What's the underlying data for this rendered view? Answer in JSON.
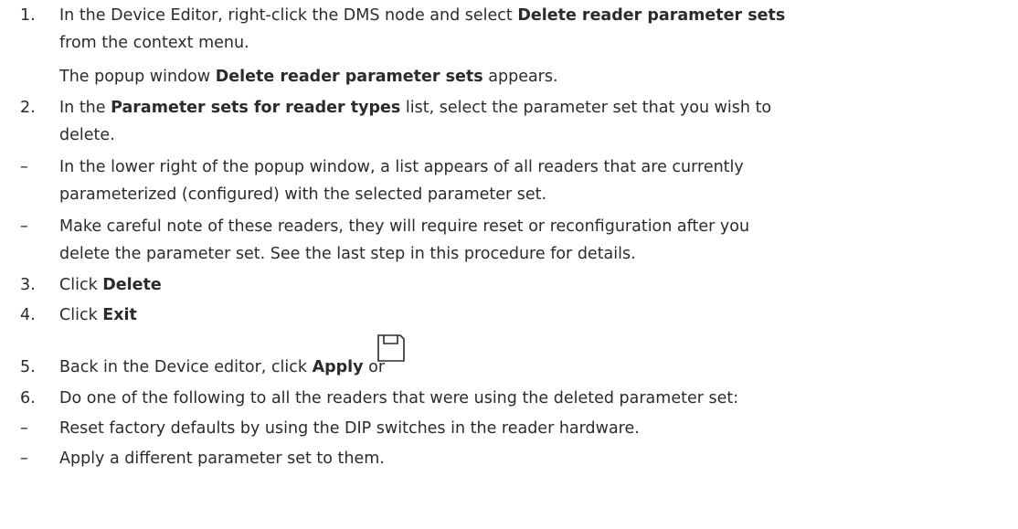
{
  "steps": [
    {
      "marker": "1.",
      "line1": {
        "pre": "In the Device Editor, right-click the DMS node and select ",
        "bold": "Delete reader parameter sets"
      },
      "line2": "from the context menu.",
      "line3": {
        "pre": "The popup window ",
        "bold": "Delete reader parameter sets",
        "post": " appears."
      }
    },
    {
      "marker": "2.",
      "line1": {
        "pre": "In the ",
        "bold": "Parameter sets for reader types",
        "post": " list, select the parameter set that you wish to"
      },
      "line2": "delete."
    },
    {
      "marker": "–",
      "line1": "In the lower right of the popup window, a list appears of all readers that are currently",
      "line2": "parameterized (configured) with the selected parameter set."
    },
    {
      "marker": "–",
      "line1": "Make careful note of these readers, they will require reset or reconfiguration after you",
      "line2": "delete the parameter set. See the last step in this procedure for details."
    },
    {
      "marker": "3.",
      "pre": "Click ",
      "bold": "Delete"
    },
    {
      "marker": "4.",
      "pre": "Click ",
      "bold": "Exit"
    },
    {
      "marker": "5.",
      "pre": "Back in the Device editor, click ",
      "bold": "Apply",
      "post": " or",
      "icon": "save-icon"
    },
    {
      "marker": "6.",
      "text": "Do one of the following to all the readers that were using the deleted parameter set:"
    },
    {
      "marker": "–",
      "text": "Reset factory defaults by using the DIP switches in the reader hardware."
    },
    {
      "marker": "–",
      "text": "Apply a different parameter set to them."
    }
  ]
}
